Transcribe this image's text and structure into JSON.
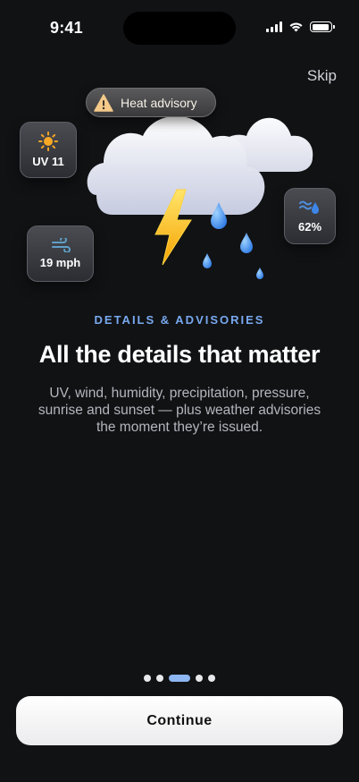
{
  "status_bar": {
    "time": "9:41"
  },
  "header": {
    "skip_label": "Skip"
  },
  "hero": {
    "advisory_label": "Heat advisory",
    "uv_label": "UV 11",
    "wind_label": "19 mph",
    "humidity_label": "62%",
    "icons": [
      "warning-icon",
      "sun-icon",
      "wind-icon",
      "humidity-icon",
      "cloud-icon",
      "lightning-icon",
      "raindrop-icon"
    ]
  },
  "content": {
    "eyebrow": "DETAILS & ADVISORIES",
    "title": "All the details that matter",
    "description": "UV, wind, humidity, precipitation, pressure, sunrise and sunset — plus weather advisories the moment they’re issued."
  },
  "pager": {
    "total": 5,
    "active_index": 2
  },
  "footer": {
    "continue_label": "Continue"
  },
  "colors": {
    "background": "#111214",
    "accent": "#78a9ef",
    "active_dot": "#8db6f2",
    "button_bg": "#ffffff"
  }
}
